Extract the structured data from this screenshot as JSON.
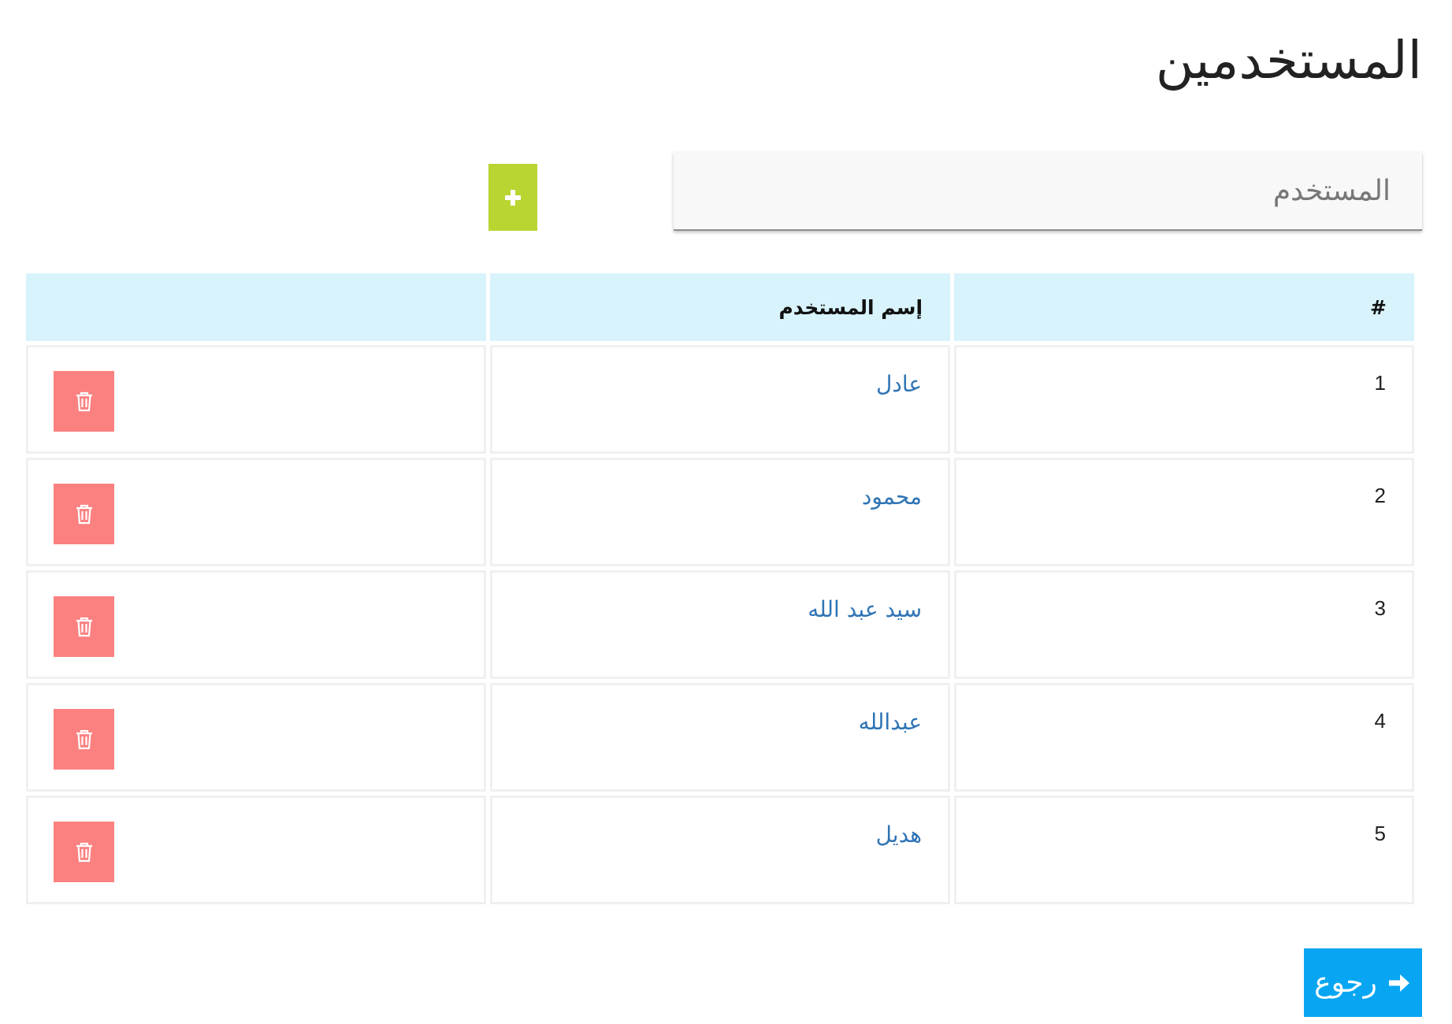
{
  "page": {
    "title": "المستخدمين"
  },
  "add_user": {
    "placeholder": "المستخدم",
    "value": "",
    "add_icon": "plus-icon"
  },
  "table": {
    "headers": [
      "#",
      "إسم المستخدم",
      ""
    ],
    "rows": [
      {
        "index": "1",
        "name": "عادل",
        "action_icon": "trash-icon"
      },
      {
        "index": "2",
        "name": "محمود",
        "action_icon": "trash-icon"
      },
      {
        "index": "3",
        "name": "سيد عبد الله",
        "action_icon": "trash-icon"
      },
      {
        "index": "4",
        "name": "عبدالله",
        "action_icon": "trash-icon"
      },
      {
        "index": "5",
        "name": "هديل",
        "action_icon": "trash-icon"
      }
    ]
  },
  "back": {
    "label": "رجوع",
    "icon": "arrow-right-icon"
  },
  "colors": {
    "add_button": "#b9d532",
    "delete_button": "#fb8181",
    "back_button": "#08a6f2",
    "table_header": "#d8f3fb",
    "link_text": "#2f74b5"
  }
}
